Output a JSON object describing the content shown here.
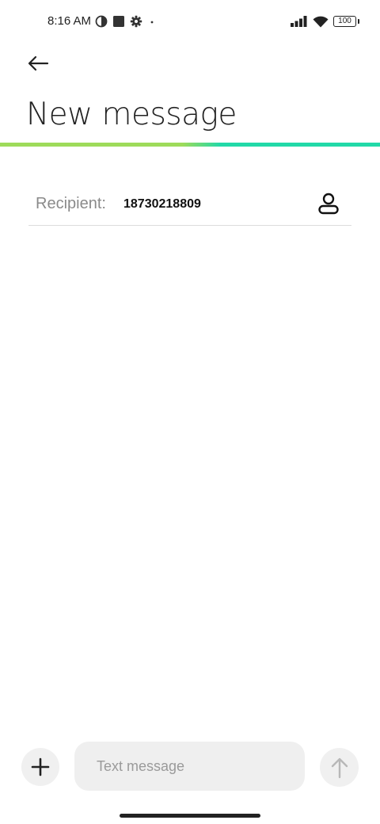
{
  "status_bar": {
    "time": "8:16 AM",
    "battery": "100",
    "icons": [
      "data-saver-icon",
      "square-notification-icon",
      "settings-gear-icon",
      "dot-icon",
      "signal-icon",
      "wifi-icon",
      "battery-icon"
    ]
  },
  "header": {
    "back_icon": "arrow-left-icon",
    "title": "New message"
  },
  "recipient": {
    "label": "Recipient:",
    "value": "18730218809",
    "contact_icon": "person-icon"
  },
  "compose": {
    "add_icon": "plus-icon",
    "placeholder": "Text message",
    "value": "",
    "send_icon": "arrow-up-icon"
  },
  "colors": {
    "accent_green": "#9edb5a",
    "accent_teal": "#22d9a8",
    "input_bg": "#efefef",
    "placeholder": "#9a9a9a"
  }
}
